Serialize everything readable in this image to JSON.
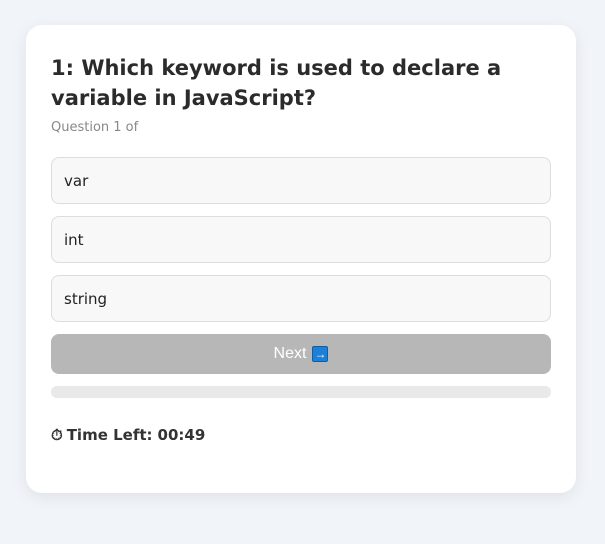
{
  "quiz": {
    "question_title": "1: Which keyword is used to declare a variable in JavaScript?",
    "question_progress": "Question 1 of",
    "options": [
      {
        "label": "var"
      },
      {
        "label": "int"
      },
      {
        "label": "string"
      }
    ],
    "next_button": {
      "label": "Next",
      "icon": "right-arrow-icon",
      "arrow": "→",
      "enabled": false
    },
    "progress_fraction": 0,
    "timer": {
      "icon": "stopwatch-icon",
      "glyph": "⏱",
      "label": "Time Left:",
      "value": "00:49"
    }
  },
  "colors": {
    "background": "#f1f4f9",
    "card": "#ffffff",
    "option_bg": "#f8f8f8",
    "option_border": "#dddddd",
    "button_disabled": "#b7b7b7",
    "progress_track": "#e9e9e9",
    "arrow_icon": "#1e7fd6"
  }
}
